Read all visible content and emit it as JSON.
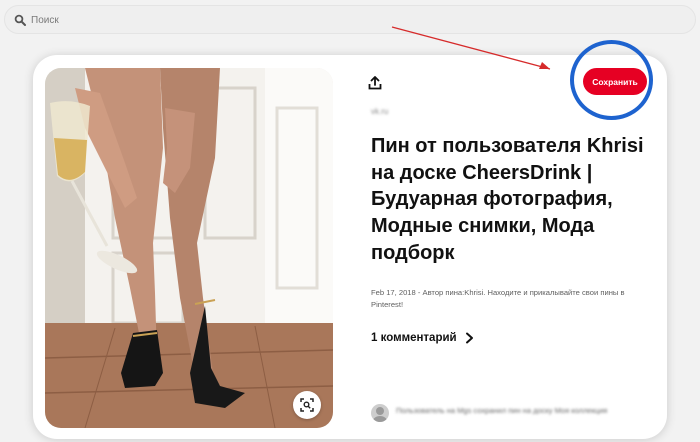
{
  "search": {
    "placeholder": "Поиск"
  },
  "pin": {
    "save_label": "Сохранить",
    "title": "Пин от пользователя Khrisi на доске CheersDrink | Будуарная фотография, Модные снимки, Мода подборк",
    "description": "Feb 17, 2018 - Автор пина:Khrisi. Находите и прикалывайте свои пины в Pinterest!",
    "comments_label": "1 комментарий",
    "blurred_site": "vk.ru",
    "blurred_comment": "Пользователь на Mgs сохранил пин на доску Моя коллекция"
  },
  "colors": {
    "save_button": "#e60023",
    "highlight_circle": "#1e63cf",
    "annotation_arrow": "#d62b2b"
  },
  "icons": [
    "search-icon",
    "share-icon",
    "visual-search-icon",
    "chevron-right-icon"
  ]
}
